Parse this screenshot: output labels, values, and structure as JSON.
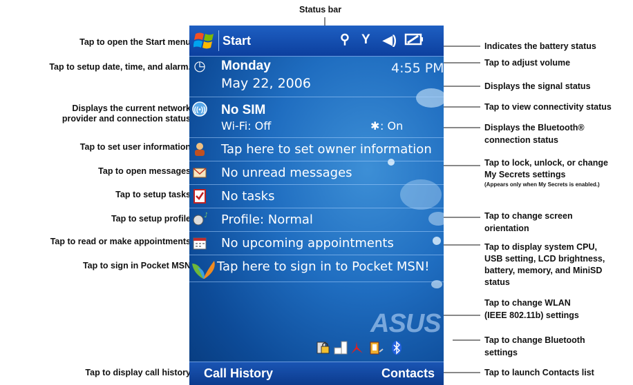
{
  "title": "Status bar",
  "left_annotations": [
    "Tap to open the Start menu",
    "Tap to setup date, time, and alarm.",
    "Displays the current network\nprovider and connection status",
    "Tap to set user information",
    "Tap to open messages",
    "Tap to setup tasks",
    "Tap to setup profile",
    "Tap to read or make appointments",
    "Tap to sign in Pocket MSN",
    "Tap to display call history"
  ],
  "right_annotations": {
    "battery": "Indicates the battery status",
    "volume": "Tap to adjust volume",
    "signal": "Displays the signal status",
    "connectivity": "Tap to view connectivity status",
    "bluetooth_status": "Displays the Bluetooth® connection status",
    "bluetooth_status_line1": "Displays the Bluetooth®",
    "bluetooth_status_line2": "connection status",
    "mysecrets_line1": "Tap to lock, unlock, or change",
    "mysecrets_line2": "My Secrets settings",
    "mysecrets_note": "(Appears only when My Secrets is enabled.)",
    "orientation_line1": "Tap to change screen",
    "orientation_line2": "orientation",
    "system_line1": "Tap to display system CPU,",
    "system_line2": "USB setting, LCD brightness,",
    "system_line3": "battery, memory, and MiniSD",
    "system_line4": "status",
    "wlan_line1": "Tap to change WLAN",
    "wlan_line2": "(IEEE 802.11b) settings",
    "bt_settings_line1": "Tap to change Bluetooth",
    "bt_settings_line2": "settings",
    "contacts": "Tap to launch Contacts list"
  },
  "screen": {
    "start_label": "Start",
    "time": "4:55 PM",
    "day": "Monday",
    "date": "May 22, 2006",
    "network": "No SIM",
    "wifi": "Wi-Fi: Off",
    "bluetooth": ": On",
    "owner": "Tap here to set owner information",
    "messages": "No unread messages",
    "tasks": "No tasks",
    "profile": "Profile: Normal",
    "appointments": "No upcoming appointments",
    "msn": "Tap here to sign in to Pocket MSN!",
    "brand": "ASUS",
    "softkey_left": "Call History",
    "softkey_right": "Contacts"
  },
  "colors": {
    "screen_blue": "#1f6dc0",
    "bar_blue": "#0c3f9e",
    "annotation_text": "#111111"
  },
  "icons": [
    "windows-flag-icon",
    "connectivity-icon",
    "signal-icon",
    "volume-icon",
    "battery-icon",
    "clock-icon",
    "network-icon",
    "bluetooth-icon",
    "owner-icon",
    "messages-icon",
    "tasks-icon",
    "profile-icon",
    "calendar-icon",
    "msn-butterfly-icon",
    "lock-icon",
    "orientation-icon",
    "system-icon",
    "wlan-icon",
    "bluetooth-tray-icon"
  ]
}
